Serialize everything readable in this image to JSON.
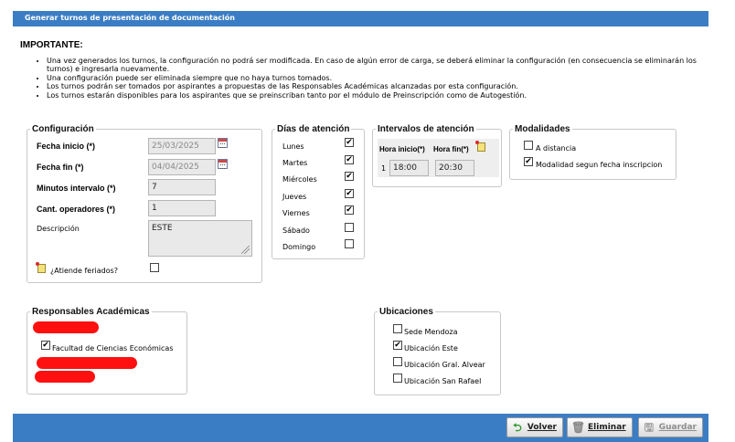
{
  "window": {
    "title": "Generar turnos de presentación de documentación"
  },
  "important": {
    "heading": "IMPORTANTE:",
    "notes": [
      "Una vez generados los turnos, la configuración no podrá ser modificada. En caso de algún error de carga, se deberá eliminar la configuración (en consecuencia se eliminarán los turnos) e ingresarla nuevamente.",
      "Una configuración puede ser eliminada siempre que no haya turnos tomados.",
      "Los turnos podrán ser tomados por aspirantes a propuestas de las Responsables Académicas alcanzadas por esta configuración.",
      "Los turnos estarán disponibles para los aspirantes que se preinscriban tanto por el módulo de Preinscripción como de Autogestión."
    ]
  },
  "config": {
    "legend": "Configuración",
    "fecha_inicio_label": "Fecha inicio (*)",
    "fecha_inicio": "25/03/2025",
    "fecha_fin_label": "Fecha fin (*)",
    "fecha_fin": "04/04/2025",
    "minutos_label": "Minutos intervalo (*)",
    "minutos": "7",
    "operadores_label": "Cant. operadores (*)",
    "operadores": "1",
    "descripcion_label": "Descripción",
    "descripcion": "ESTE",
    "feriados_label": "¿Atiende feriados?",
    "feriados_checked": false
  },
  "dias": {
    "legend": "Días de atención",
    "items": [
      {
        "label": "Lunes",
        "checked": "✔"
      },
      {
        "label": "Martes",
        "checked": "✔"
      },
      {
        "label": "Miércoles",
        "checked": "✔"
      },
      {
        "label": "Jueves",
        "checked": "✔"
      },
      {
        "label": "Viernes",
        "checked": "✔"
      },
      {
        "label": "Sábado",
        "checked": ""
      },
      {
        "label": "Domingo",
        "checked": ""
      }
    ]
  },
  "intervalos": {
    "legend": "Intervalos de atención",
    "col_inicio": "Hora inicio(*)",
    "col_fin": "Hora fin(*)",
    "rows": [
      {
        "num": "1",
        "inicio": "18:00",
        "fin": "20:30"
      }
    ]
  },
  "modalidades": {
    "legend": "Modalidades",
    "items": [
      {
        "label": "A distancia",
        "checked": ""
      },
      {
        "label": "Modalidad segun fecha inscripcion",
        "checked": "✔"
      }
    ]
  },
  "responsables": {
    "legend": "Responsables Académicas",
    "items": [
      {
        "label": "Facultad de Ciencias Económicas",
        "checked": "✔"
      }
    ]
  },
  "ubicaciones": {
    "legend": "Ubicaciones",
    "items": [
      {
        "label": "Sede Mendoza",
        "checked": ""
      },
      {
        "label": "Ubicación Este",
        "checked": "✔"
      },
      {
        "label": "Ubicación Gral. Alvear",
        "checked": ""
      },
      {
        "label": "Ubicación San Rafael",
        "checked": ""
      }
    ]
  },
  "buttons": {
    "volver": "Volver",
    "eliminar": "Eliminar",
    "guardar": "Guardar"
  },
  "colors": {
    "header_blue": "#3b7dc4",
    "redaction": "#ff1010"
  }
}
